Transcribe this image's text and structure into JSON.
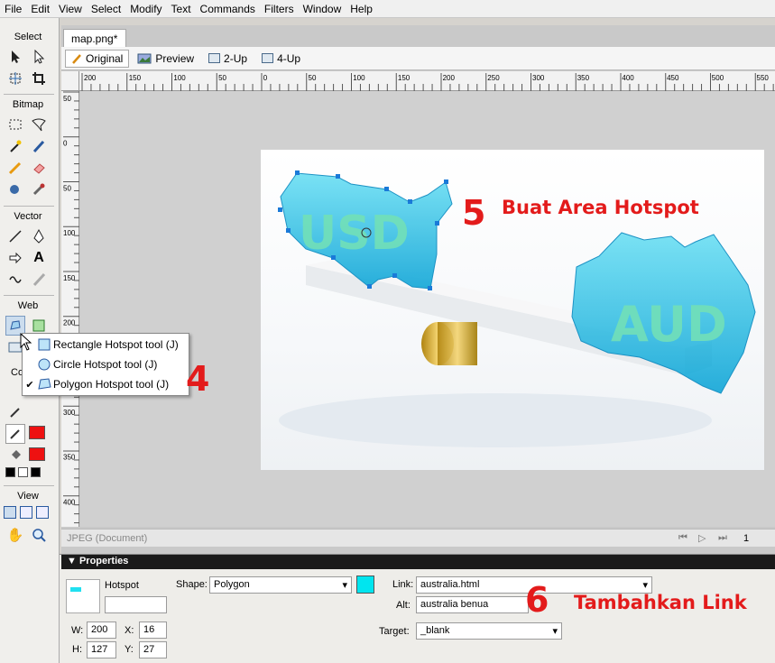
{
  "menu": [
    "File",
    "Edit",
    "View",
    "Select",
    "Modify",
    "Text",
    "Commands",
    "Filters",
    "Window",
    "Help"
  ],
  "toolbox": {
    "select": "Select",
    "bitmap": "Bitmap",
    "vector": "Vector",
    "web": "Web",
    "colors": "Co",
    "view": "View"
  },
  "document": {
    "tab": "map.png*",
    "views": [
      "Original",
      "Preview",
      "2-Up",
      "4-Up"
    ],
    "ruler_h": [
      "200",
      "150",
      "100",
      "50",
      "0",
      "50",
      "100",
      "150",
      "200",
      "250",
      "300",
      "350",
      "400",
      "450",
      "500",
      "550"
    ],
    "ruler_v": [
      "50",
      "0",
      "50",
      "100",
      "150",
      "200",
      "250",
      "300",
      "350",
      "400"
    ],
    "status": "JPEG (Document)",
    "page": "1"
  },
  "image": {
    "left_label": "USD",
    "right_label": "AUD"
  },
  "popup": {
    "items": [
      "Rectangle Hotspot tool (J)",
      "Circle Hotspot tool (J)",
      "Polygon Hotspot tool (J)"
    ],
    "checked": 2
  },
  "annotations": {
    "num4": "4",
    "num5": "5",
    "num6": "6",
    "step5": "Buat Area Hotspot",
    "step6": "Tambahkan Link",
    "color": "#e31b1b"
  },
  "properties": {
    "title": "Properties",
    "object": "Hotspot",
    "shape_label": "Shape:",
    "shape_value": "Polygon",
    "hotspot_color": "#00e5ef",
    "link_label": "Link:",
    "link_value": "australia.html",
    "alt_label": "Alt:",
    "alt_value": "australia benua",
    "target_label": "Target:",
    "target_value": "_blank",
    "w_label": "W:",
    "w": "200",
    "h_label": "H:",
    "h": "127",
    "x_label": "X:",
    "x": "16",
    "y_label": "Y:",
    "y": "27"
  },
  "colors": {
    "stroke": "#ee1111",
    "fill": "#ee1111",
    "accent": "#00c8e8"
  }
}
